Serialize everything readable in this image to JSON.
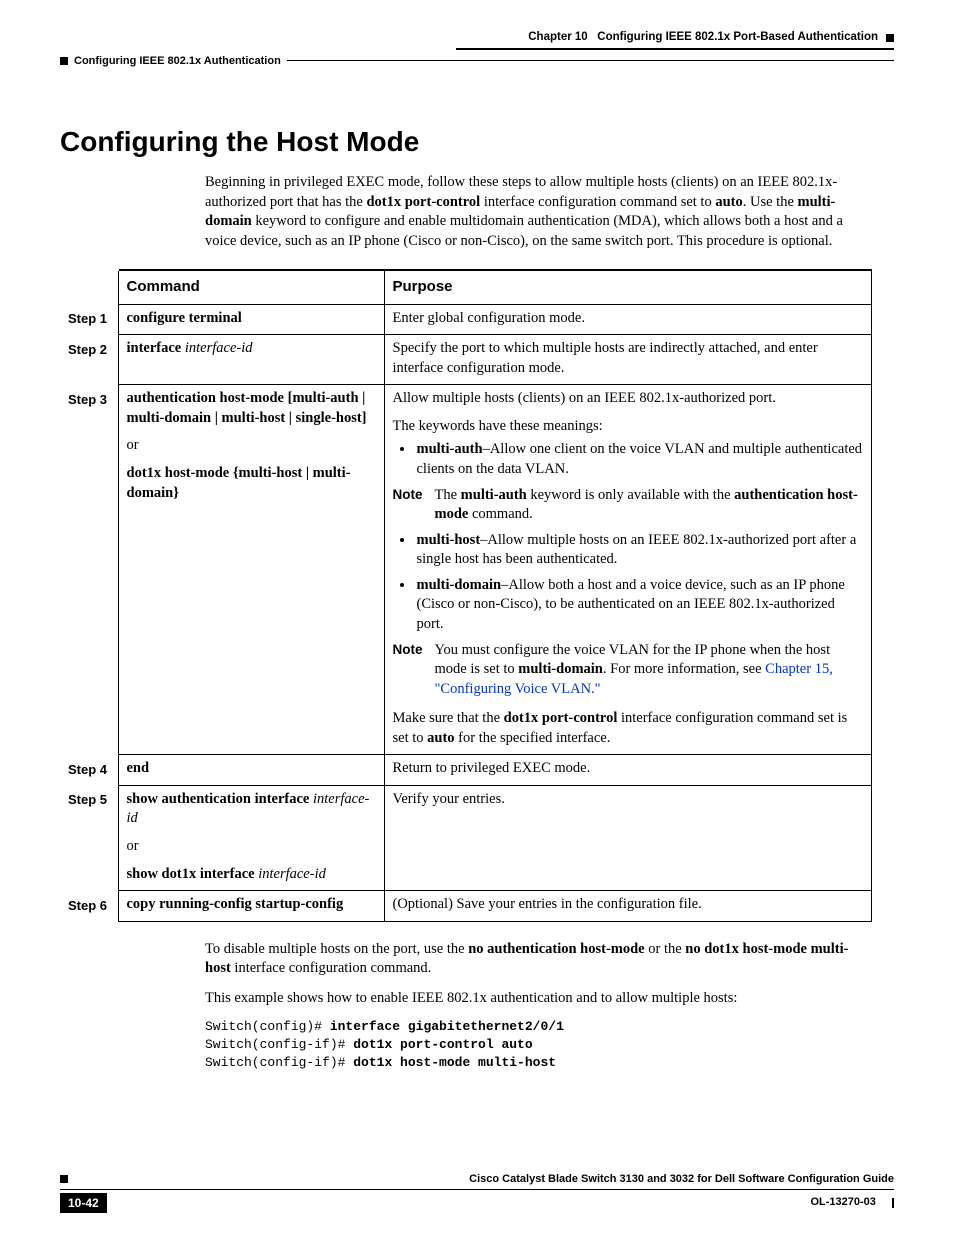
{
  "header": {
    "chapter": "Chapter 10",
    "title": "Configuring IEEE 802.1x Port-Based Authentication",
    "subtitle": "Configuring IEEE 802.1x Authentication"
  },
  "section_title": "Configuring the Host Mode",
  "intro": {
    "p1_a": "Beginning in privileged EXEC mode, follow these steps to allow multiple hosts (clients) on an IEEE 802.1x-authorized port that has the ",
    "p1_cmd": "dot1x port-control",
    "p1_b": " interface configuration command set to ",
    "p1_auto": "auto",
    "p1_c": ". Use the ",
    "p1_md": "multi-domain",
    "p1_d": " keyword to configure and enable multidomain authentication (MDA), which allows both a host and a voice device, such as an IP phone (Cisco or non-Cisco), on the same switch port. This procedure is optional."
  },
  "table": {
    "h_command": "Command",
    "h_purpose": "Purpose",
    "steps": {
      "s1": "Step 1",
      "s2": "Step 2",
      "s3": "Step 3",
      "s4": "Step 4",
      "s5": "Step 5",
      "s6": "Step 6"
    },
    "r1": {
      "cmd": "configure terminal",
      "purpose": "Enter global configuration mode."
    },
    "r2": {
      "cmd_b": "interface",
      "cmd_i": " interface-id",
      "purpose": "Specify the port to which multiple hosts are indirectly attached, and enter interface configuration mode."
    },
    "r3": {
      "cmd1": "authentication host-mode",
      "cmd1_opts": " [multi-auth | multi-domain | multi-host | single-host]",
      "or": "or",
      "cmd2": "dot1x host-mode {multi-host | multi-domain}",
      "p_intro": "Allow multiple hosts (clients) on an IEEE 802.1x-authorized port.",
      "p_keywords": "The keywords have these meanings:",
      "li1_b": "multi-auth",
      "li1_t": "–Allow one client on the voice VLAN and multiple authenticated clients on the data VLAN.",
      "note1_lbl": "Note",
      "note1_a": "The ",
      "note1_b": "multi-auth",
      "note1_c": " keyword is only available with the ",
      "note1_d": "authentication host-mode",
      "note1_e": " command.",
      "li2_b": "multi-host",
      "li2_t": "–Allow multiple hosts on an IEEE 802.1x-authorized port after a single host has been authenticated.",
      "li3_b": "multi-domain",
      "li3_t": "–Allow both a host and a voice device, such as an IP phone (Cisco or non-Cisco), to be authenticated on an IEEE 802.1x-authorized port.",
      "note2_lbl": "Note",
      "note2_a": "You must configure the voice VLAN for the IP phone when the host mode is set to ",
      "note2_b": "multi-domain",
      "note2_c": ". For more information, see ",
      "note2_link": "Chapter 15, \"Configuring Voice VLAN.\"",
      "p_last_a": "Make sure that the ",
      "p_last_b": "dot1x port-control",
      "p_last_c": " interface configuration command set is set to ",
      "p_last_d": "auto",
      "p_last_e": " for the specified interface."
    },
    "r4": {
      "cmd": "end",
      "purpose": "Return to privileged EXEC mode."
    },
    "r5": {
      "cmd1": "show authentication interface",
      "cmd1_i": "interface-id",
      "or": "or",
      "cmd2_b": "show dot1x interface",
      "cmd2_i": " interface-id",
      "purpose": "Verify your entries."
    },
    "r6": {
      "cmd": "copy running-config startup-config",
      "purpose": "(Optional) Save your entries in the configuration file."
    }
  },
  "after": {
    "p2_a": "To disable multiple hosts on the port, use the ",
    "p2_b1": "no authentication host-mode",
    "p2_c": " or the ",
    "p2_b2": "no dot1x host-mode multi-host",
    "p2_d": " interface configuration command.",
    "p3": "This example shows how to enable IEEE 802.1x authentication and to allow multiple hosts:"
  },
  "example": {
    "l1_p": "Switch(config)# ",
    "l1_c": "interface gigabitethernet2/0/1",
    "l2_p": "Switch(config-if)# ",
    "l2_c": "dot1x port-control auto",
    "l3_p": "Switch(config-if)# ",
    "l3_c": "dot1x host-mode multi-host"
  },
  "footer": {
    "guide": "Cisco Catalyst Blade Switch 3130 and 3032 for Dell Software Configuration Guide",
    "page": "10-42",
    "docnum": "OL-13270-03"
  }
}
